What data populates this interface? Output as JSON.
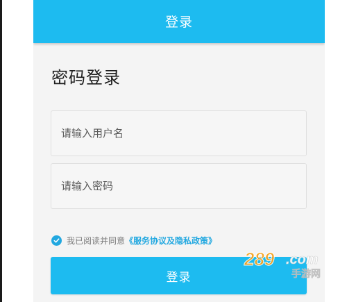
{
  "header": {
    "title": "登录"
  },
  "page": {
    "title": "密码登录"
  },
  "form": {
    "username_placeholder": "请输入用户名",
    "username_value": "",
    "password_placeholder": "请输入密码",
    "password_value": ""
  },
  "agreement": {
    "checked": true,
    "text": "我已阅读并同意",
    "link_text": "《服务协议及隐私政策》"
  },
  "submit": {
    "label": "登录"
  },
  "watermark": {
    "text_top": "289.com",
    "text_bottom": "手游网"
  },
  "colors": {
    "accent": "#1dbbf0",
    "link": "#22a8e0",
    "background": "#f4f4f4"
  }
}
